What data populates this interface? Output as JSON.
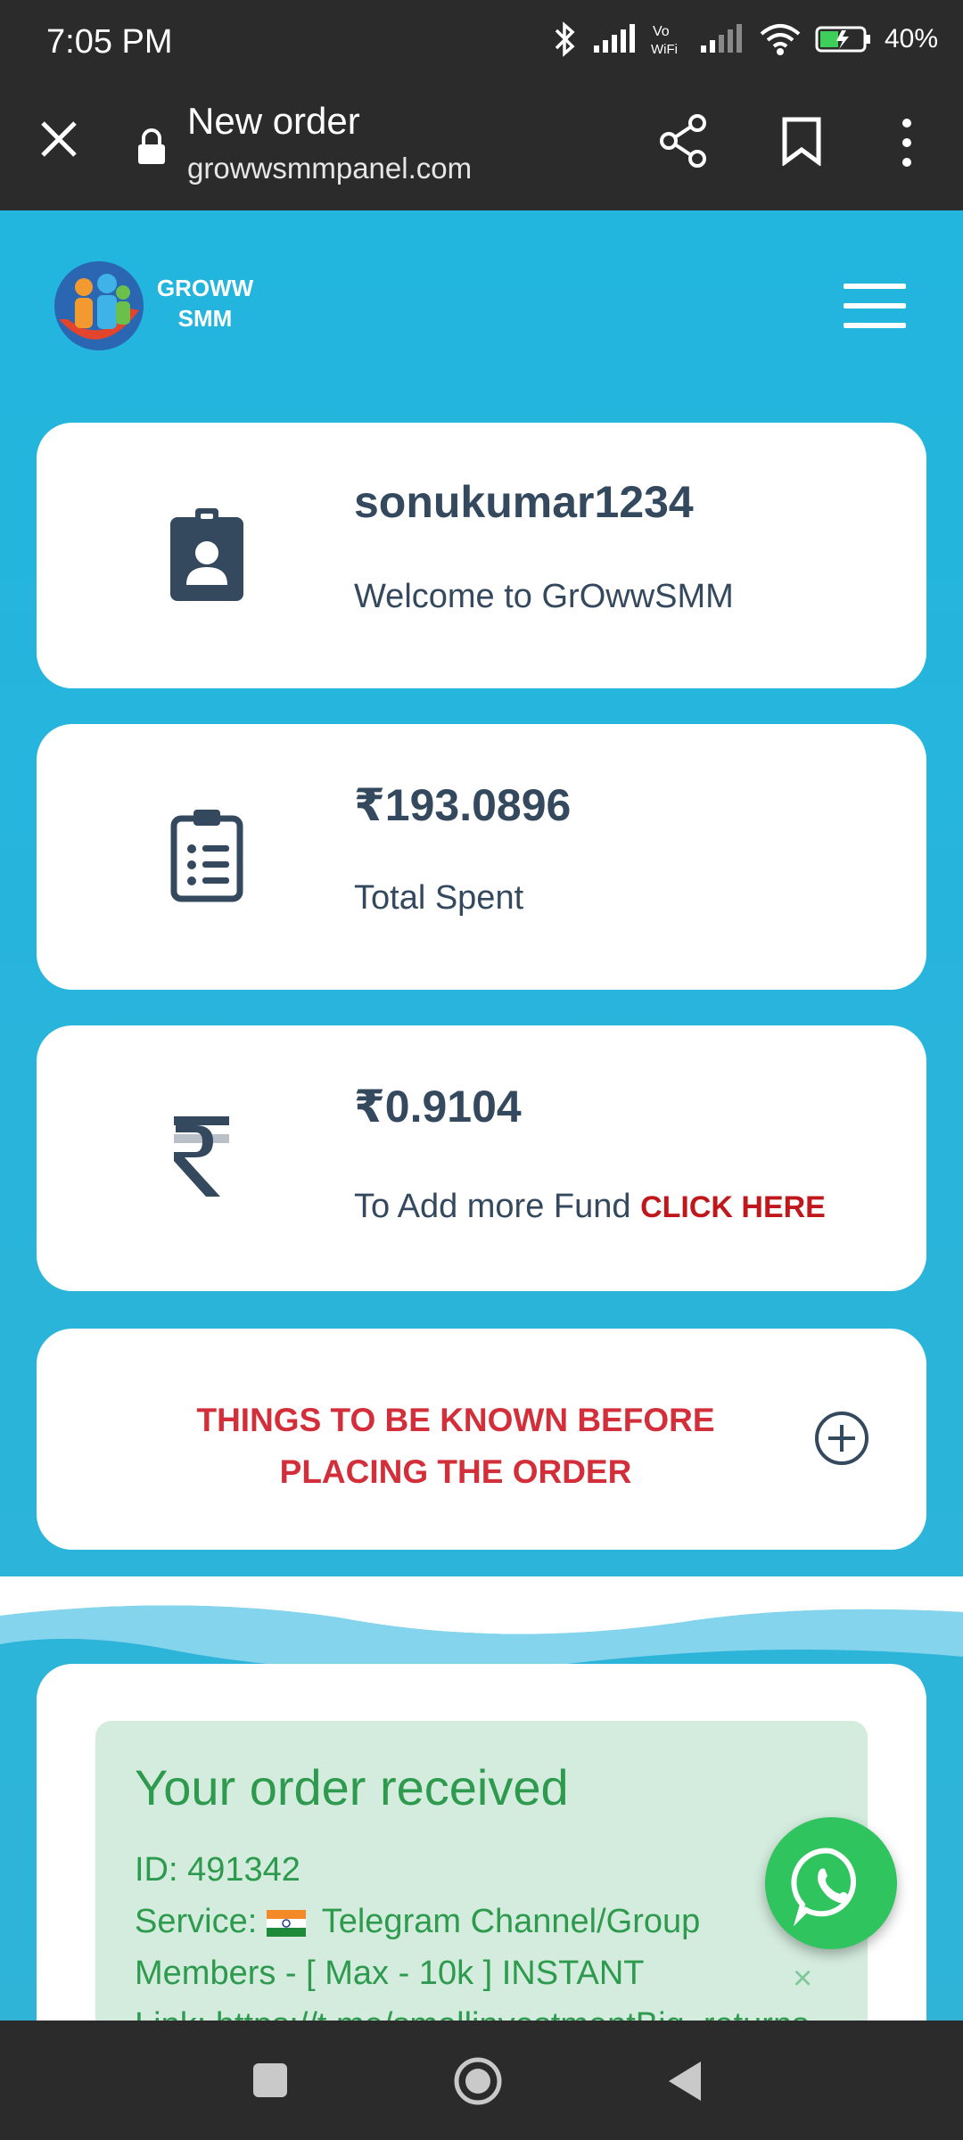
{
  "status_bar": {
    "time": "7:05 PM",
    "battery": "40%"
  },
  "browser": {
    "page_title": "New order",
    "domain": "growwsmmpanel.com"
  },
  "header": {
    "brand_line1": "GROWW",
    "brand_line2": "SMM"
  },
  "cards": {
    "user": {
      "username": "sonukumar1234",
      "welcome": "Welcome to GrOwwSMM"
    },
    "spent": {
      "amount": "₹193.0896",
      "label": "Total Spent"
    },
    "balance": {
      "amount": "₹0.9104",
      "label": "To Add more Fund",
      "link": "CLICK HERE"
    },
    "notice": {
      "line1": "THINGS TO BE KNOWN BEFORE",
      "line2": "PLACING THE ORDER"
    }
  },
  "order_alert": {
    "title": "Your order received",
    "id_line": "ID: 491342",
    "service_prefix": "Service:",
    "service_text": "Telegram Channel/Group Members - [ Max - 10k ] INSTANT",
    "link_line": "Link: https://t.me/smallinvestmentBig_returns",
    "close": "×"
  },
  "colors": {
    "accent": "#22b5de",
    "text_dark": "#34495e",
    "alert_red": "#d32f3a",
    "success_green": "#2e9a4e",
    "whatsapp": "#2fc45e"
  }
}
